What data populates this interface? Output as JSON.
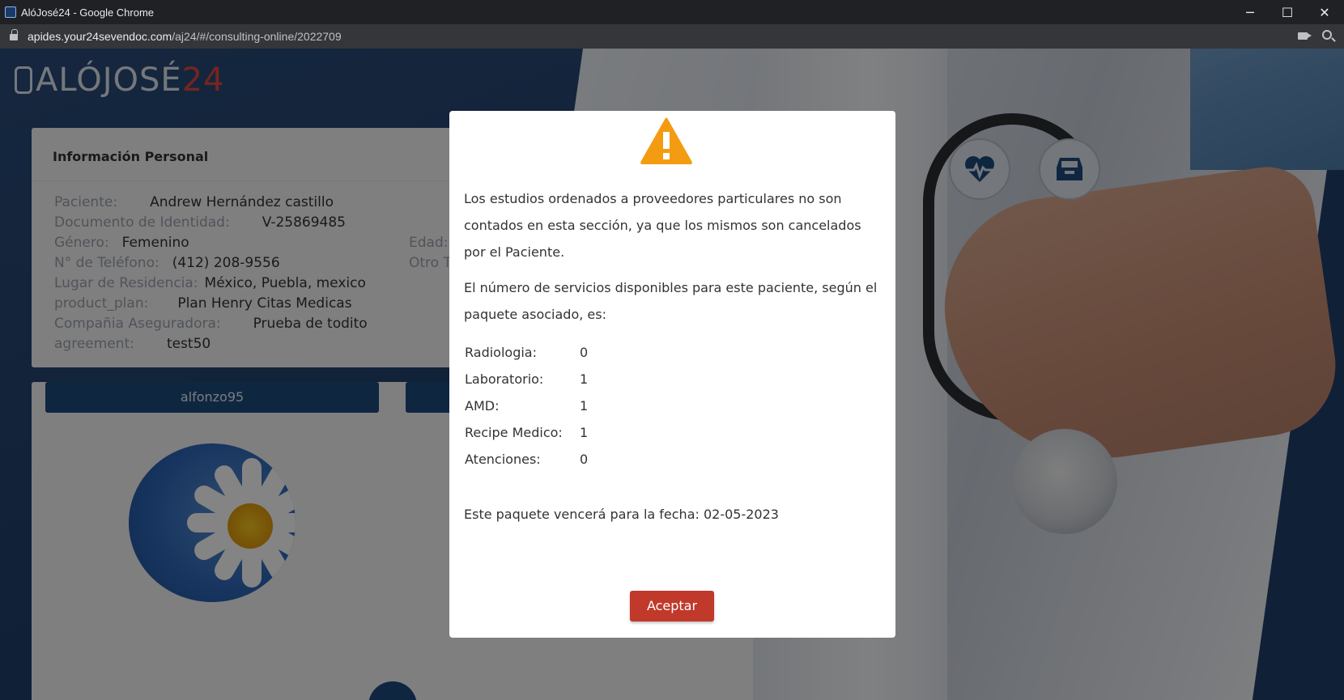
{
  "window": {
    "title": "AlóJosé24 - Google Chrome",
    "controls": {
      "minimize": "─",
      "maximize": "☐",
      "close": "✕"
    }
  },
  "address_bar": {
    "host": "apides.your24sevendoc.com",
    "path": "/aj24/#/consulting-online/2022709"
  },
  "brand": {
    "logo_main": "ALÓJOSÉ",
    "logo_accent": "24"
  },
  "personal_info": {
    "title": "Información Personal",
    "rows": [
      {
        "label": "Paciente:",
        "value": "Andrew Hernández castillo"
      },
      {
        "label": "Documento de Identidad:",
        "value": "V-25869485"
      },
      {
        "label": "Género:",
        "value": "Femenino"
      },
      {
        "label": "N° de Teléfono:",
        "value": "(412) 208-9556"
      },
      {
        "label": "Lugar de Residencia:",
        "value": "México, Puebla, mexico"
      },
      {
        "label": "product_plan:",
        "value": "Plan Henry Citas Medicas"
      },
      {
        "label": "Compañia Aseguradora:",
        "value": "Prueba de todito"
      },
      {
        "label": "agreement:",
        "value": "test50"
      }
    ],
    "right_labels": [
      "Edad:",
      "Otro T"
    ]
  },
  "user_card": {
    "username": "alfonzo95"
  },
  "icons": [
    "heartbeat-icon",
    "archive-box-icon",
    "warning-icon",
    "lock-icon",
    "camera-icon",
    "zoom-icon"
  ],
  "modal": {
    "paragraph1": "Los estudios ordenados a proveedores particulares no son contados en esta sección, ya que los mismos son cancelados por el Paciente.",
    "paragraph2": "El número de servicios disponibles para este paciente, según el paquete asociado, es:",
    "services": [
      {
        "name": "Radiologia:",
        "count": "0"
      },
      {
        "name": "Laboratorio:",
        "count": "1"
      },
      {
        "name": "AMD:",
        "count": "1"
      },
      {
        "name": "Recipe Medico:",
        "count": "1"
      },
      {
        "name": "Atenciones:",
        "count": "0"
      }
    ],
    "expiry": "Este paquete vencerá para la fecha: 02-05-2023",
    "accept_label": "Aceptar"
  },
  "colors": {
    "warning": "#f39c12",
    "accept": "#c0392b",
    "brand_blue": "#1e4a7c",
    "logo_accent": "#e3463d"
  }
}
